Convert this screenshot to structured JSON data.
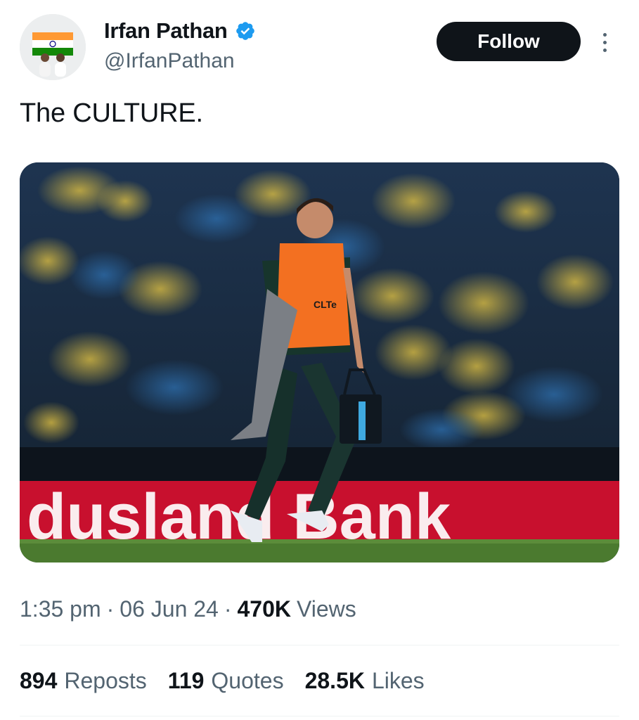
{
  "author": {
    "display_name": "Irfan Pathan",
    "handle": "@IrfanPathan",
    "verified": true,
    "avatar_icon": "profile-photo-with-indian-flag"
  },
  "actions": {
    "follow_label": "Follow",
    "more_icon": "vertical-ellipsis-icon"
  },
  "tweet": {
    "text": "The CULTURE.",
    "media_description_icon": "cricket-player-carrying-drinks-photo"
  },
  "meta": {
    "time": "1:35 pm",
    "separator": "·",
    "date": "06 Jun 24",
    "views_count": "470K",
    "views_label": "Views"
  },
  "stats": {
    "reposts_count": "894",
    "reposts_label": "Reposts",
    "quotes_count": "119",
    "quotes_label": "Quotes",
    "likes_count": "28.5K",
    "likes_label": "Likes"
  },
  "colors": {
    "text_primary": "#0f1419",
    "text_secondary": "#536471",
    "verified_blue": "#1d9bf0",
    "follow_bg": "#0f1419",
    "divider": "#eff3f4"
  }
}
